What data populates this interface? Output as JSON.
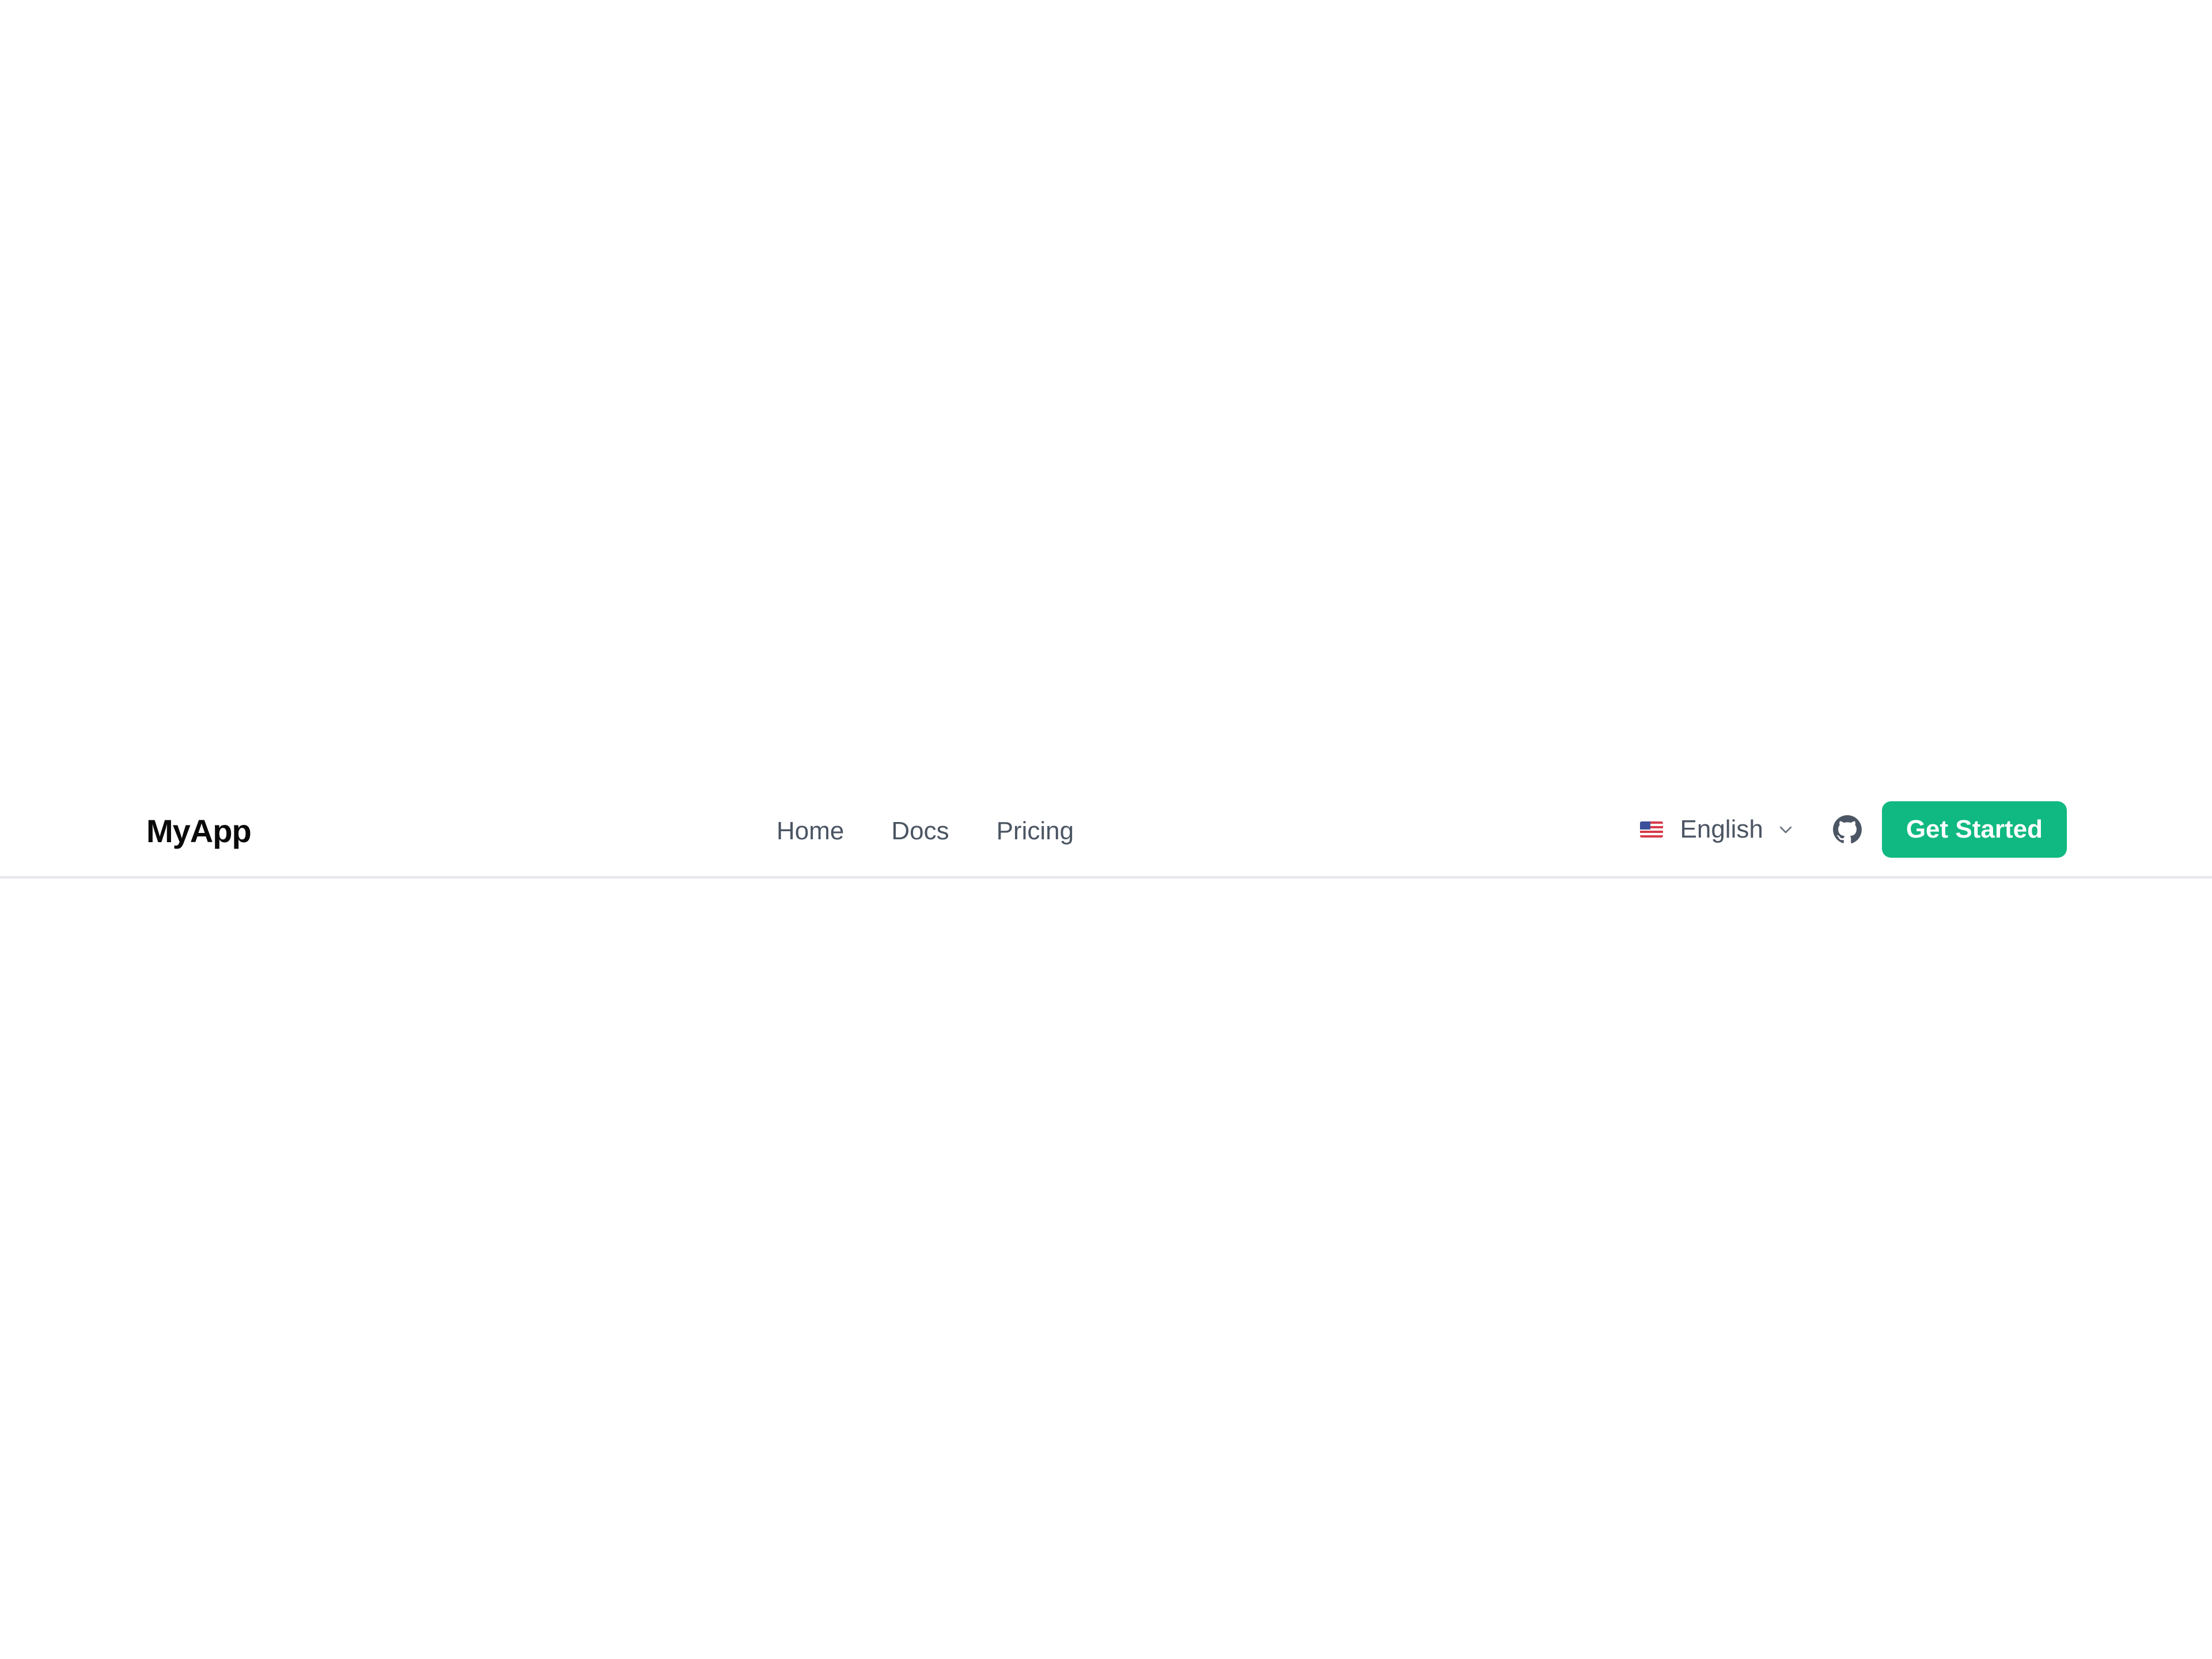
{
  "navbar": {
    "brand": "MyApp",
    "links": [
      {
        "label": "Home"
      },
      {
        "label": "Docs"
      },
      {
        "label": "Pricing"
      }
    ],
    "language": {
      "flag_icon": "us-flag-icon",
      "selected": "English",
      "dropdown_icon": "chevron-down-icon"
    },
    "github_icon": "github-icon",
    "cta_label": "Get Started"
  },
  "colors": {
    "accent": "#10b981",
    "nav_text": "#4b5563",
    "brand_text": "#0a0a0a",
    "divider": "#e5e7eb",
    "background": "#ffffff"
  }
}
